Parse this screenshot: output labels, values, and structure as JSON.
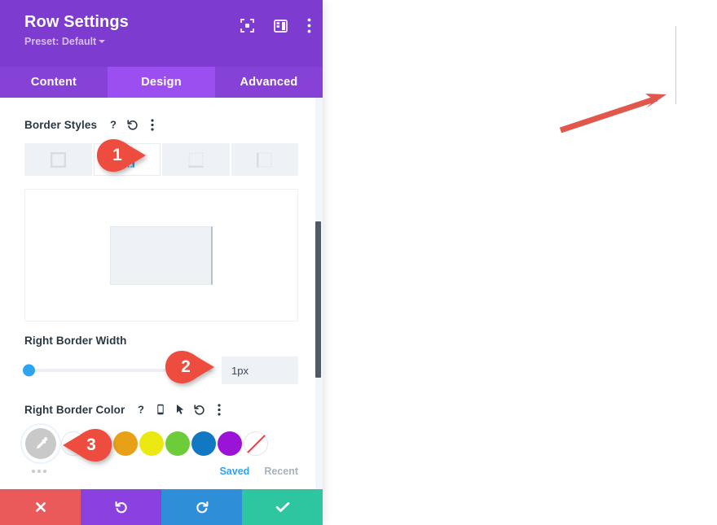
{
  "panel": {
    "title": "Row Settings",
    "preset_label": "Preset: Default",
    "header_icons": [
      {
        "name": "focus-icon",
        "label": "Focus"
      },
      {
        "name": "layout-icon",
        "label": "Layout"
      },
      {
        "name": "more-vertical-icon",
        "label": "More options"
      }
    ],
    "tabs": [
      {
        "label": "Content",
        "active": false
      },
      {
        "label": "Design",
        "active": true
      },
      {
        "label": "Advanced",
        "active": false
      }
    ]
  },
  "border_styles": {
    "label": "Border Styles",
    "icons": [
      "help-icon",
      "reset-icon",
      "more-vertical-icon"
    ],
    "options": [
      {
        "name": "border-all",
        "active": false
      },
      {
        "name": "border-right",
        "active": true
      },
      {
        "name": "border-bottom",
        "active": false
      },
      {
        "name": "border-left",
        "active": false
      }
    ],
    "hidden_option_index": 1
  },
  "preview": {
    "name": "border-preview",
    "fill_color": "#eef2f7",
    "right_border_color": "#b9bfc6"
  },
  "border_width": {
    "label": "Right Border Width",
    "value": "1px",
    "placeholder": "1px",
    "slider_percent": 2
  },
  "border_color": {
    "label": "Right Border Color",
    "icons": [
      "help-icon",
      "mobile-icon",
      "cursor-icon",
      "reset-icon",
      "more-vertical-icon"
    ],
    "picker_name": "eyedropper-icon",
    "swatches": [
      {
        "name": "swatch-white",
        "color": "#ffffff"
      },
      {
        "name": "swatch-red",
        "color": "#e02b27"
      },
      {
        "name": "swatch-orange",
        "color": "#e8a117"
      },
      {
        "name": "swatch-yellow",
        "color": "#ece811"
      },
      {
        "name": "swatch-green",
        "color": "#6dcc3a"
      },
      {
        "name": "swatch-blue",
        "color": "#1278c4"
      },
      {
        "name": "swatch-purple",
        "color": "#9a13d6"
      },
      {
        "name": "swatch-none",
        "color": "transparent"
      }
    ],
    "tabs": [
      {
        "label": "Saved",
        "active": true
      },
      {
        "label": "Recent",
        "active": false
      }
    ]
  },
  "actions": [
    {
      "name": "cancel-button",
      "icon": "close-icon",
      "color": "#eb5a5a"
    },
    {
      "name": "undo-button",
      "icon": "undo-icon",
      "color": "#8b41e0"
    },
    {
      "name": "redo-button",
      "icon": "redo-icon",
      "color": "#2e8fd8"
    },
    {
      "name": "save-button",
      "icon": "checkmark-icon",
      "color": "#2dc6a0"
    }
  ],
  "callouts": [
    {
      "number": "1",
      "color": "#ed4c3f"
    },
    {
      "number": "2",
      "color": "#ed4c3f"
    },
    {
      "number": "3",
      "color": "#ed4c3f"
    }
  ],
  "annotation": {
    "arrow_name": "pointer-arrow",
    "arrow_color": "#e2574c",
    "target_name": "rendered-right-border-line"
  },
  "colors": {
    "header_purple": "#7e3bd0",
    "tab_purple": "#8642d7",
    "active_tab_purple": "#9b4ff0",
    "accent_blue": "#2ea3f2"
  }
}
